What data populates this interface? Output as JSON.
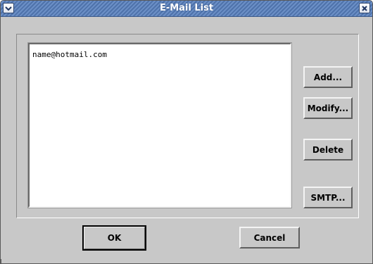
{
  "window": {
    "title": "E-Mail List",
    "icons": {
      "menu": "chevron-down-icon",
      "close": "close-icon"
    },
    "colors": {
      "title_bar": "#5b7fb6",
      "background": "#c8c8c8"
    }
  },
  "email_list": {
    "items": [
      "name@hotmail.com"
    ]
  },
  "buttons": {
    "add": "Add...",
    "modify": "Modify...",
    "delete": "Delete",
    "smtp": "SMTP...",
    "ok": "OK",
    "cancel": "Cancel"
  }
}
